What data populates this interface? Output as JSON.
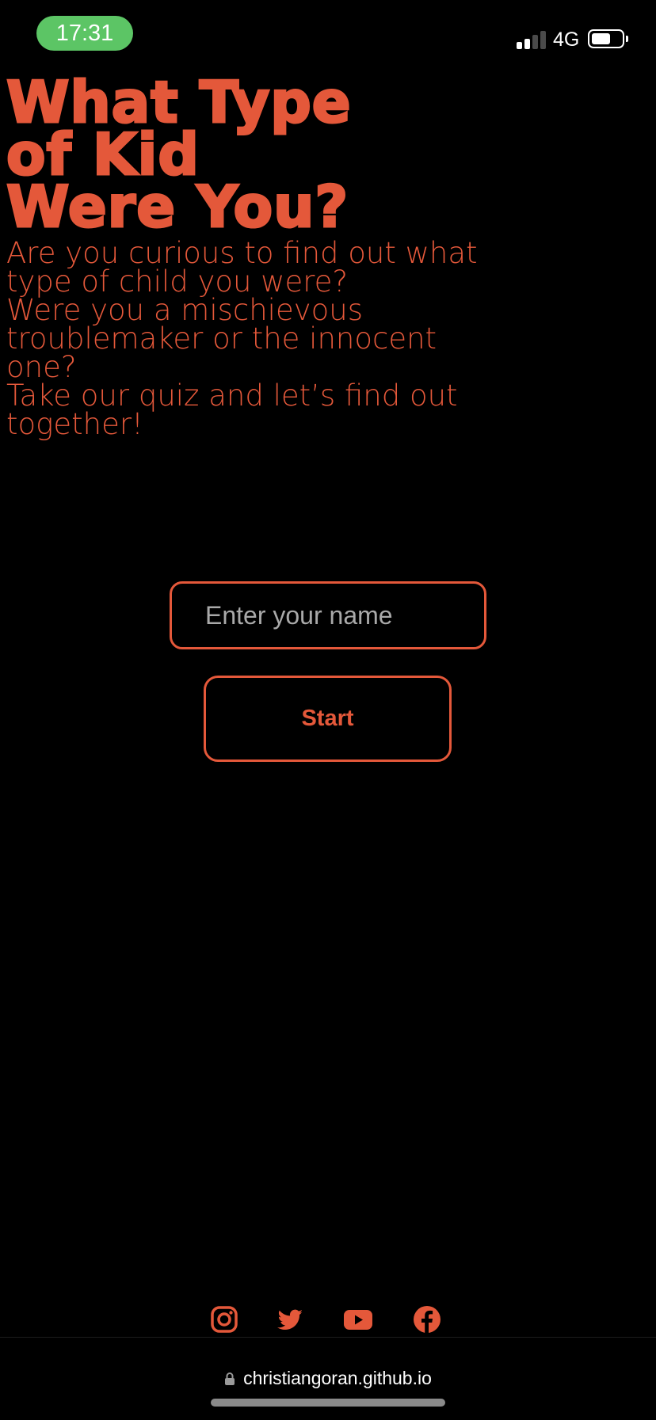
{
  "status_bar": {
    "time": "17:31",
    "network": "4G",
    "battery_level": 0.65,
    "signal_bars": 2
  },
  "colors": {
    "accent": "#e4583a",
    "background": "#000000",
    "time_pill": "#5cc565"
  },
  "hero": {
    "title_lines": [
      "What Type",
      "of Kid",
      "Were You?"
    ],
    "intro_lines": [
      "Are you curious to find out what",
      "type of child you were?",
      "Were you a mischievous",
      "troublemaker or the innocent",
      "one?",
      "Take our quiz and let’s find out",
      "together!"
    ]
  },
  "form": {
    "name_placeholder": "Enter your name",
    "name_value": "",
    "start_label": "Start"
  },
  "social": {
    "icons": [
      "instagram-icon",
      "twitter-icon",
      "youtube-icon",
      "facebook-icon"
    ]
  },
  "browser": {
    "url": "christiangoran.github.io"
  }
}
